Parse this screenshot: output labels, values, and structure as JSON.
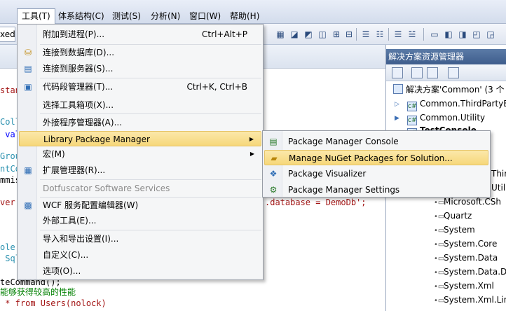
{
  "menubar": {
    "items": [
      {
        "label": "工具(T)"
      },
      {
        "label": "体系结构(C)"
      },
      {
        "label": "测试(S)"
      },
      {
        "label": "分析(N)"
      },
      {
        "label": "窗口(W)"
      },
      {
        "label": "帮助(H)"
      }
    ]
  },
  "toolbar": {
    "config_value": "xed"
  },
  "editor": {
    "lines": [
      {
        "text": "stan",
        "color": "red"
      },
      {
        "text": "Coll",
        "color": "teal"
      },
      {
        "text": " val",
        "color": "blue"
      },
      {
        "text": "Grou",
        "color": "teal"
      },
      {
        "text": "ntCo",
        "color": "teal"
      },
      {
        "text": "mmis",
        "color": "dark"
      },
      {
        "text": "ver",
        "color": "red"
      },
      {
        "text": ".database = DemoDb';",
        "color": "red"
      },
      {
        "text": "ole(",
        "color": "teal"
      },
      {
        "text": " Sql",
        "color": "teal"
      },
      {
        "text": "teCommand();",
        "color": "dark"
      },
      {
        "text": "能够获得较高的性能",
        "color": "green"
      },
      {
        "text": " * from Users(nolock)",
        "color": "red"
      }
    ]
  },
  "tools_menu": {
    "items": [
      {
        "label": "附加到进程(P)...",
        "shortcut": "Ctrl+Alt+P",
        "icon": "attach-process-icon"
      },
      {
        "label": "连接到数据库(D)...",
        "shortcut": "",
        "icon": "connect-database-icon"
      },
      {
        "label": "连接到服务器(S)...",
        "shortcut": "",
        "icon": "connect-server-icon"
      },
      {
        "label": "代码段管理器(T)...",
        "shortcut": "Ctrl+K, Ctrl+B",
        "icon": "snippet-manager-icon"
      },
      {
        "label": "选择工具箱项(X)...",
        "shortcut": "",
        "icon": ""
      },
      {
        "label": "外接程序管理器(A)...",
        "shortcut": "",
        "icon": ""
      },
      {
        "label": "Library Package Manager",
        "shortcut": "",
        "icon": ""
      },
      {
        "label": "宏(M)",
        "shortcut": "",
        "icon": ""
      },
      {
        "label": "扩展管理器(R)...",
        "shortcut": "",
        "icon": "extension-manager-icon"
      },
      {
        "label": "Dotfuscator Software Services",
        "shortcut": "",
        "icon": ""
      },
      {
        "label": "WCF 服务配置编辑器(W)",
        "shortcut": "",
        "icon": "wcf-config-icon"
      },
      {
        "label": "外部工具(E)...",
        "shortcut": "",
        "icon": ""
      },
      {
        "label": "导入和导出设置(I)...",
        "shortcut": "",
        "icon": ""
      },
      {
        "label": "自定义(C)...",
        "shortcut": "",
        "icon": ""
      },
      {
        "label": "选项(O)...",
        "shortcut": "",
        "icon": ""
      }
    ]
  },
  "package_submenu": {
    "items": [
      {
        "label": "Package Manager Console",
        "icon": "console-icon"
      },
      {
        "label": "Manage NuGet Packages for Solution...",
        "icon": "nuget-package-icon"
      },
      {
        "label": "Package Visualizer",
        "icon": "visualizer-icon"
      },
      {
        "label": "Package Manager Settings",
        "icon": "settings-icon"
      }
    ]
  },
  "solution_explorer": {
    "title": "解决方案资源管理器",
    "solution_label": "解决方案'Common' (3 个",
    "projects": [
      "Common.ThirdPartyE",
      "Common.Utility",
      "TestConsole"
    ],
    "partial_refs": [
      "Third",
      "Utilit"
    ],
    "references": [
      "Microsoft.CSh",
      "Quartz",
      "System",
      "System.Core",
      "System.Data",
      "System.Data.D",
      "System.Xml",
      "System.Xml.Lin"
    ]
  }
}
